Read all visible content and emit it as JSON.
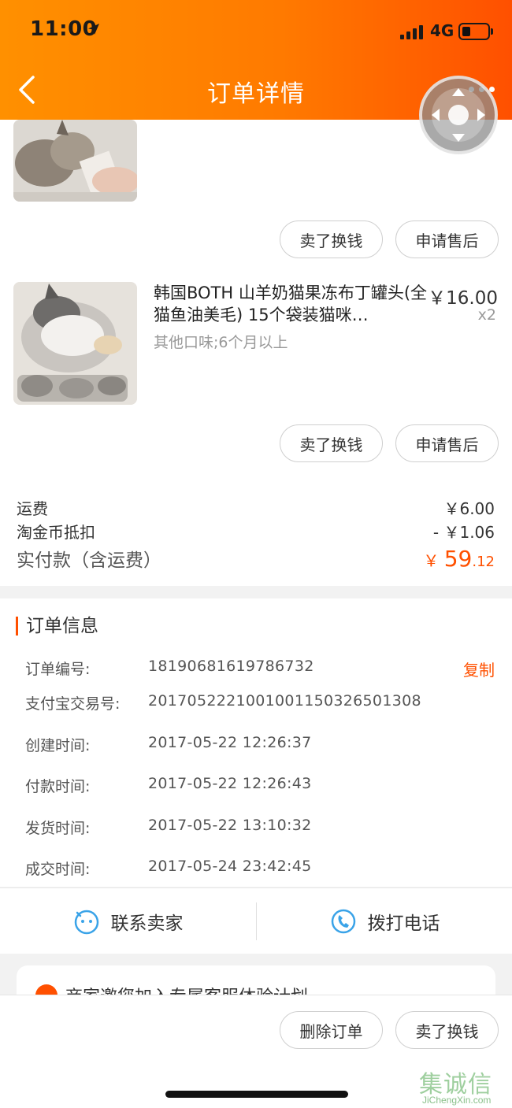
{
  "status_bar": {
    "time": "11:00",
    "network": "4G"
  },
  "nav": {
    "title": "订单详情"
  },
  "items": [
    {
      "title": "",
      "buttons": [
        "卖了换钱",
        "申请售后"
      ]
    },
    {
      "title": "韩国BOTH 山羊奶猫果冻布丁罐头(全猫鱼油美毛) 15个袋装猫咪…",
      "spec": "其他口味;6个月以上",
      "price": "￥16.00",
      "qty": "x2",
      "buttons": [
        "卖了换钱",
        "申请售后"
      ]
    }
  ],
  "fees": {
    "shipping_label": "运费",
    "shipping_value": "￥6.00",
    "coin_label": "淘金币抵扣",
    "coin_value": "- ￥1.06",
    "total_label": "实付款（含运费）",
    "total_currency": "￥",
    "total_int": "59",
    "total_dec": ".12"
  },
  "order_info": {
    "title": "订单信息",
    "copy_label": "复制",
    "rows": [
      {
        "label": "订单编号:",
        "value": "18190681619786732"
      },
      {
        "label": "支付宝交易号:",
        "value": "2017052221001001150326501308"
      },
      {
        "label": "创建时间:",
        "value": "2017-05-22 12:26:37"
      },
      {
        "label": "付款时间:",
        "value": "2017-05-22 12:26:43"
      },
      {
        "label": "发货时间:",
        "value": "2017-05-22 13:10:32"
      },
      {
        "label": "成交时间:",
        "value": "2017-05-24 23:42:45"
      }
    ]
  },
  "contact": {
    "seller": "联系卖家",
    "phone": "拨打电话"
  },
  "promo": {
    "text": "商家邀您加入专属客服体验计划"
  },
  "bottom": {
    "delete": "删除订单",
    "resell": "卖了换钱"
  },
  "watermark": {
    "cn": "集诚信",
    "en": "JiChengXin.com"
  },
  "colors": {
    "accent": "#ff5000",
    "header_start": "#ff9000",
    "contact_icon": "#3aa3e8"
  }
}
